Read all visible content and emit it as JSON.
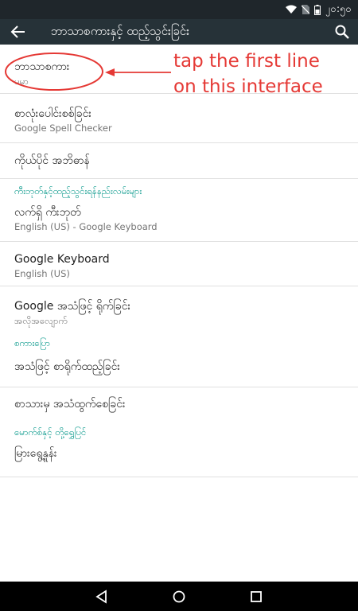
{
  "status_bar": {
    "time": "၂၀:၅၀"
  },
  "app_bar": {
    "title": "ဘာသာစကားနှင့် ထည့်သွင်းခြင်း"
  },
  "items": [
    {
      "title": "ဘာသာစကား",
      "subtitle": "မမာ"
    },
    {
      "title": "စာလုံးပေါင်းစစ်ခြင်း",
      "subtitle": "Google Spell Checker"
    },
    {
      "title": "ကိုယ်ပိုင် အဘိဓာန်"
    }
  ],
  "section_keyboard": {
    "header": "ကီးဘုတ်နှင့်ထည့်သွင်းရန်နည်းလမ်းများ",
    "items": [
      {
        "title": "လက်ရှိ ကီးဘုတ်",
        "subtitle": "English (US) - Google Keyboard"
      },
      {
        "title": "Google Keyboard",
        "subtitle": "English (US)"
      },
      {
        "title": "Google အသံဖြင့် ရိုက်ခြင်း",
        "subtitle": "အလိုအလျောက်"
      }
    ]
  },
  "section_speech": {
    "header": "စကားပြော",
    "items": [
      {
        "title": "အသံဖြင့် စာရိုက်ထည့်ခြင်း"
      },
      {
        "title": "စာသားမှ အသံထွက်စေခြင်း"
      }
    ]
  },
  "section_mouse": {
    "header": "မောက်စ်နှင့် တို့ရွှေပြင်",
    "items": [
      {
        "title": "မြားရွေ့နှုန်း"
      }
    ]
  },
  "annotation": {
    "text": "tap the first line\non this interface",
    "color": "#e53935"
  },
  "colors": {
    "accent": "#009688",
    "app_bar": "#263238",
    "status_bar": "#1f262b",
    "annotation": "#e53935"
  }
}
